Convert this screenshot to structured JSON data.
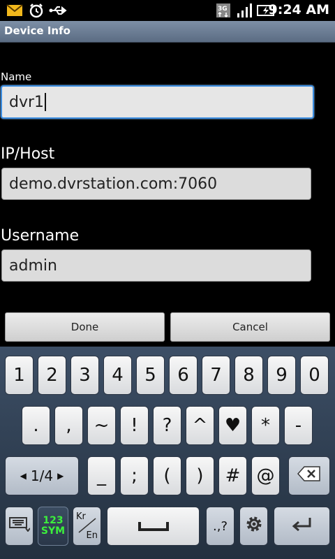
{
  "status_bar": {
    "time": "9:24 AM",
    "network": "3G",
    "icons": [
      "mail-icon",
      "alarm-icon",
      "usb-icon",
      "network-3g-icon",
      "signal-icon",
      "battery-charging-icon"
    ]
  },
  "title_bar": {
    "title": "Device Info"
  },
  "form": {
    "name_label": "Name",
    "name_value": "dvr1",
    "host_label": "IP/Host",
    "host_value": "demo.dvrstation.com:7060",
    "username_label": "Username",
    "username_value": "admin"
  },
  "buttons": {
    "done": "Done",
    "cancel": "Cancel"
  },
  "keyboard": {
    "row1": [
      "1",
      "2",
      "3",
      "4",
      "5",
      "6",
      "7",
      "8",
      "9",
      "0"
    ],
    "row2": [
      ".",
      ",",
      "~",
      "!",
      "?",
      "^",
      "♥",
      "*",
      "-"
    ],
    "row3_keys": [
      "_",
      ";",
      "(",
      ")",
      "#",
      "@"
    ],
    "page_indicator": "1/4",
    "mode_key_top": "123",
    "mode_key_bottom": "SYM",
    "lang_key_top": "Kr",
    "lang_key_bottom": "En",
    "punct_key": ".,?",
    "accent_color": "#3b8de0",
    "sym_color": "#3cf03c"
  }
}
